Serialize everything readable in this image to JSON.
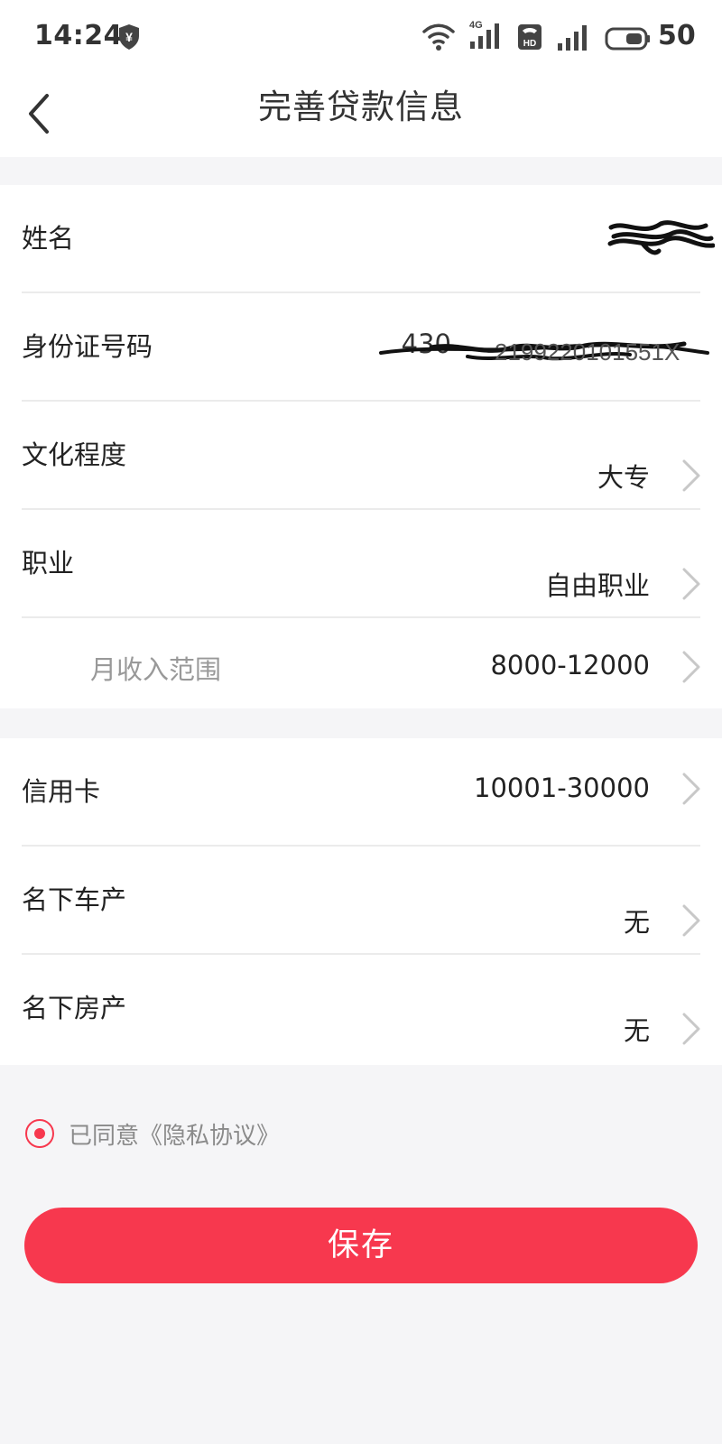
{
  "status_bar": {
    "time": "14:24",
    "network_label": "4G",
    "battery": "50"
  },
  "nav": {
    "title": "完善贷款信息"
  },
  "form": {
    "name": {
      "label": "姓名",
      "value": ""
    },
    "id_number": {
      "label": "身份证号码",
      "value": "430"
    },
    "education": {
      "label": "文化程度",
      "value": "大专"
    },
    "occupation": {
      "label": "职业",
      "value": "自由职业"
    },
    "monthly_income": {
      "label": "月收入范围",
      "value": "8000-12000"
    },
    "credit_card": {
      "label": "信用卡",
      "value": "10001-30000"
    },
    "car": {
      "label": "名下车产",
      "value": "无"
    },
    "house": {
      "label": "名下房产",
      "value": "无"
    }
  },
  "agreement": {
    "checked": true,
    "text": "已同意《隐私协议》"
  },
  "save_label": "保存",
  "colors": {
    "accent": "#f7384e",
    "background": "#f5f5f7",
    "card": "#ffffff",
    "muted_text": "#999999"
  },
  "icons": {
    "back": "back-arrow-icon",
    "chevron": "chevron-right-icon",
    "wifi": "wifi-icon",
    "signal": "cellular-signal-icon",
    "hd": "hd-voice-icon",
    "battery": "battery-icon",
    "shield": "shield-yuan-icon"
  }
}
